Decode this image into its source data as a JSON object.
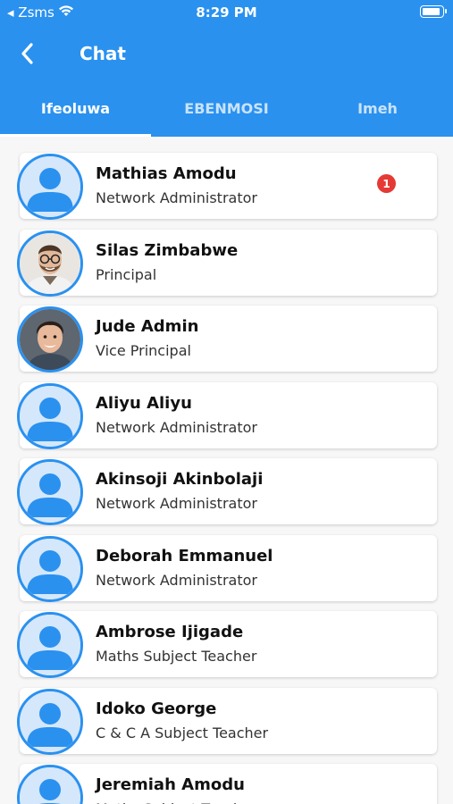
{
  "status_bar": {
    "carrier": "◂ Zsms",
    "time": "8:29 PM",
    "battery_level": 0.95
  },
  "header": {
    "title": "Chat",
    "back_icon": "chevron-left-icon"
  },
  "tabs": [
    {
      "label": "Ifeoluwa",
      "active": true
    },
    {
      "label": "EBENMOSI",
      "active": false
    },
    {
      "label": "Imeh",
      "active": false
    }
  ],
  "colors": {
    "primary": "#2a91ef",
    "badge": "#e53935",
    "avatar_bg": "#d5e7fb"
  },
  "contacts": [
    {
      "name": "Mathias Amodu",
      "role": "Network Administrator",
      "avatar": "default-avatar-icon",
      "badge": "1"
    },
    {
      "name": "Silas Zimbabwe",
      "role": "Principal",
      "avatar": "photo-man-glasses"
    },
    {
      "name": "Jude Admin",
      "role": "Vice Principal",
      "avatar": "photo-boy"
    },
    {
      "name": "Aliyu Aliyu",
      "role": "Network Administrator",
      "avatar": "default-avatar-icon"
    },
    {
      "name": "Akinsoji Akinbolaji",
      "role": "Network Administrator",
      "avatar": "default-avatar-icon"
    },
    {
      "name": "Deborah Emmanuel",
      "role": "Network Administrator",
      "avatar": "default-avatar-icon"
    },
    {
      "name": "Ambrose Ijigade",
      "role": "Maths Subject Teacher",
      "avatar": "default-avatar-icon"
    },
    {
      "name": "Idoko George",
      "role": "C & C A Subject Teacher",
      "avatar": "default-avatar-icon"
    },
    {
      "name": "Jeremiah Amodu",
      "role": "Maths Subject Teacher",
      "avatar": "default-avatar-icon"
    }
  ]
}
